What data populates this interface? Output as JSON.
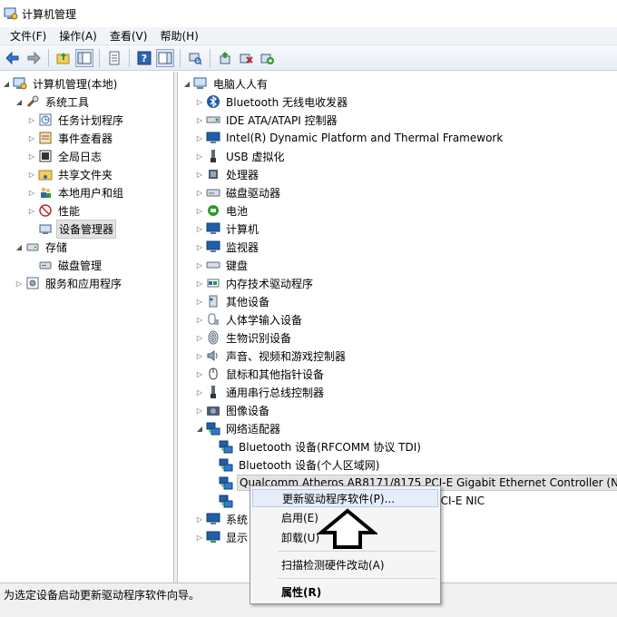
{
  "window": {
    "title": "计算机管理"
  },
  "menu": [
    "文件(F)",
    "操作(A)",
    "查看(V)",
    "帮助(H)"
  ],
  "left_tree": [
    {
      "label": "计算机管理(本地)",
      "level": 0,
      "expander": "down",
      "icon": "computer-management-icon"
    },
    {
      "label": "系统工具",
      "level": 1,
      "expander": "down",
      "icon": "system-tools-icon"
    },
    {
      "label": "任务计划程序",
      "level": 2,
      "expander": "right",
      "icon": "task-scheduler-icon"
    },
    {
      "label": "事件查看器",
      "level": 2,
      "expander": "right",
      "icon": "event-viewer-icon"
    },
    {
      "label": "全局日志",
      "level": 2,
      "expander": "right",
      "icon": "global-log-icon"
    },
    {
      "label": "共享文件夹",
      "level": 2,
      "expander": "right",
      "icon": "shared-folder-icon"
    },
    {
      "label": "本地用户和组",
      "level": 2,
      "expander": "right",
      "icon": "local-users-icon"
    },
    {
      "label": "性能",
      "level": 2,
      "expander": "right",
      "icon": "performance-icon"
    },
    {
      "label": "设备管理器",
      "level": 2,
      "expander": "none",
      "icon": "device-manager-icon",
      "selected": true
    },
    {
      "label": "存储",
      "level": 1,
      "expander": "down",
      "icon": "storage-icon"
    },
    {
      "label": "磁盘管理",
      "level": 2,
      "expander": "none",
      "icon": "disk-management-icon"
    },
    {
      "label": "服务和应用程序",
      "level": 1,
      "expander": "right",
      "icon": "services-apps-icon"
    }
  ],
  "right_tree": [
    {
      "label": "电脑人人有",
      "level": 0,
      "expander": "down",
      "icon": "computer-icon"
    },
    {
      "label": "Bluetooth 无线电收发器",
      "level": 1,
      "expander": "right",
      "icon": "bluetooth-icon"
    },
    {
      "label": "IDE ATA/ATAPI 控制器",
      "level": 1,
      "expander": "right",
      "icon": "ide-controller-icon"
    },
    {
      "label": "Intel(R) Dynamic Platform and Thermal Framework",
      "level": 1,
      "expander": "right",
      "icon": "monitor-icon"
    },
    {
      "label": "USB 虚拟化",
      "level": 1,
      "expander": "right",
      "icon": "usb-icon"
    },
    {
      "label": "处理器",
      "level": 1,
      "expander": "right",
      "icon": "processor-icon"
    },
    {
      "label": "磁盘驱动器",
      "level": 1,
      "expander": "right",
      "icon": "disk-drive-icon"
    },
    {
      "label": "电池",
      "level": 1,
      "expander": "right",
      "icon": "battery-icon"
    },
    {
      "label": "计算机",
      "level": 1,
      "expander": "right",
      "icon": "monitor-icon"
    },
    {
      "label": "监视器",
      "level": 1,
      "expander": "right",
      "icon": "monitor-icon"
    },
    {
      "label": "键盘",
      "level": 1,
      "expander": "right",
      "icon": "keyboard-icon"
    },
    {
      "label": "内存技术驱动程序",
      "level": 1,
      "expander": "right",
      "icon": "memory-tech-icon"
    },
    {
      "label": "其他设备",
      "level": 1,
      "expander": "right",
      "icon": "other-devices-icon"
    },
    {
      "label": "人体学输入设备",
      "level": 1,
      "expander": "right",
      "icon": "hid-icon"
    },
    {
      "label": "生物识别设备",
      "level": 1,
      "expander": "right",
      "icon": "biometric-icon"
    },
    {
      "label": "声音、视频和游戏控制器",
      "level": 1,
      "expander": "right",
      "icon": "sound-icon"
    },
    {
      "label": "鼠标和其他指针设备",
      "level": 1,
      "expander": "right",
      "icon": "mouse-icon"
    },
    {
      "label": "通用串行总线控制器",
      "level": 1,
      "expander": "right",
      "icon": "usb-controller-icon"
    },
    {
      "label": "图像设备",
      "level": 1,
      "expander": "right",
      "icon": "imaging-icon"
    },
    {
      "label": "网络适配器",
      "level": 1,
      "expander": "down",
      "icon": "network-adapter-icon"
    },
    {
      "label": "Bluetooth 设备(RFCOMM 协议 TDI)",
      "level": 2,
      "expander": "none",
      "icon": "network-adapter-icon"
    },
    {
      "label": "Bluetooth 设备(个人区域网)",
      "level": 2,
      "expander": "none",
      "icon": "network-adapter-icon"
    },
    {
      "label": "Qualcomm Atheros AR8171/8175 PCI-E Gigabit Ethernet Controller (N",
      "level": 2,
      "expander": "none",
      "icon": "network-adapter-icon",
      "selected": true
    },
    {
      "label": "1ac PCI-E NIC",
      "level": 2,
      "expander": "none",
      "icon": "network-adapter-icon",
      "partial": true
    },
    {
      "label": "系统",
      "level": 1,
      "expander": "right",
      "icon": "system-devices-icon"
    },
    {
      "label": "显示",
      "level": 1,
      "expander": "right",
      "icon": "display-adapter-icon"
    }
  ],
  "context_menu": [
    {
      "label": "更新驱动程序软件(P)...",
      "hover": true
    },
    {
      "label": "启用(E)"
    },
    {
      "label": "卸载(U)"
    },
    {
      "separator": true
    },
    {
      "label": "扫描检测硬件改动(A)"
    },
    {
      "separator": true
    },
    {
      "label": "属性(R)",
      "bold": true
    }
  ],
  "status": {
    "text": "为选定设备启动更新驱动程序软件向导。"
  },
  "colors": {
    "accent": "#1f5fa8",
    "icon_green": "#2e9a2e",
    "icon_red": "#c0282d",
    "selection": "#e3e3e3"
  }
}
